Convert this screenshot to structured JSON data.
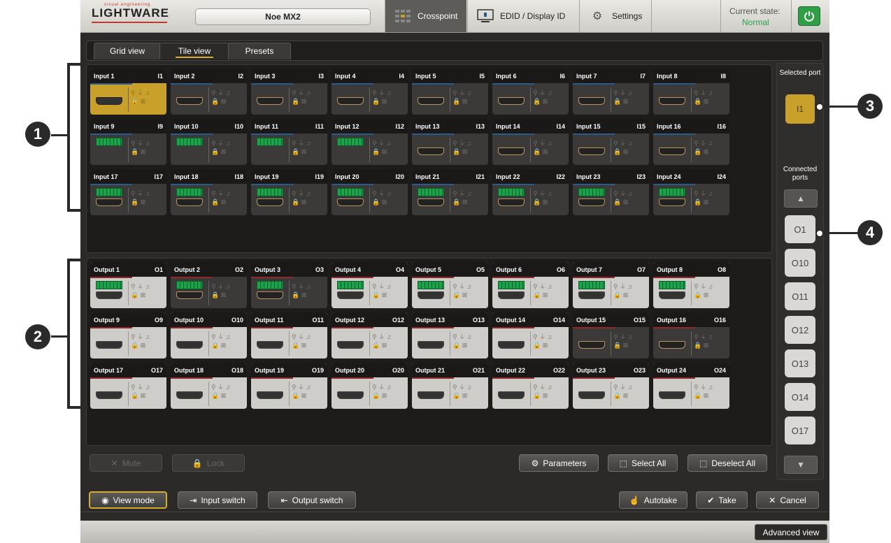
{
  "app": {
    "logo_text": "LIGHTWARE",
    "logo_tagline": "visual engineering",
    "device_name": "Noe MX2",
    "nav": {
      "crosspoint": "Crosspoint",
      "edid": "EDID / Display ID",
      "settings": "Settings"
    },
    "current_state_label": "Current state:",
    "current_state_value": "Normal"
  },
  "tabs": {
    "grid": "Grid view",
    "tile": "Tile view",
    "presets": "Presets"
  },
  "inputs": [
    {
      "label": "Input 1",
      "id": "I1",
      "kind": "hdmi",
      "selected": true
    },
    {
      "label": "Input 2",
      "id": "I2",
      "kind": "hdmi"
    },
    {
      "label": "Input 3",
      "id": "I3",
      "kind": "hdmi"
    },
    {
      "label": "Input 4",
      "id": "I4",
      "kind": "hdmi"
    },
    {
      "label": "Input 5",
      "id": "I5",
      "kind": "hdmi"
    },
    {
      "label": "Input 6",
      "id": "I6",
      "kind": "hdmi"
    },
    {
      "label": "Input 7",
      "id": "I7",
      "kind": "hdmi"
    },
    {
      "label": "Input 8",
      "id": "I8",
      "kind": "hdmi"
    },
    {
      "label": "Input 9",
      "id": "I9",
      "kind": "audio"
    },
    {
      "label": "Input 10",
      "id": "I10",
      "kind": "audio"
    },
    {
      "label": "Input 11",
      "id": "I11",
      "kind": "audio"
    },
    {
      "label": "Input 12",
      "id": "I12",
      "kind": "audio"
    },
    {
      "label": "Input 13",
      "id": "I13",
      "kind": "hdmi"
    },
    {
      "label": "Input 14",
      "id": "I14",
      "kind": "hdmi"
    },
    {
      "label": "Input 15",
      "id": "I15",
      "kind": "hdmi"
    },
    {
      "label": "Input 16",
      "id": "I16",
      "kind": "hdmi"
    },
    {
      "label": "Input 17",
      "id": "I17",
      "kind": "audio+hdmi"
    },
    {
      "label": "Input 18",
      "id": "I18",
      "kind": "audio+hdmi"
    },
    {
      "label": "Input 19",
      "id": "I19",
      "kind": "audio+hdmi"
    },
    {
      "label": "Input 20",
      "id": "I20",
      "kind": "audio+hdmi"
    },
    {
      "label": "Input 21",
      "id": "I21",
      "kind": "audio+hdmi"
    },
    {
      "label": "Input 22",
      "id": "I22",
      "kind": "audio+hdmi"
    },
    {
      "label": "Input 23",
      "id": "I23",
      "kind": "audio+hdmi"
    },
    {
      "label": "Input 24",
      "id": "I24",
      "kind": "audio+hdmi"
    }
  ],
  "outputs": [
    {
      "label": "Output 1",
      "id": "O1",
      "kind": "audio+hdmi",
      "connected": true
    },
    {
      "label": "Output 2",
      "id": "O2",
      "kind": "audio+hdmi"
    },
    {
      "label": "Output 3",
      "id": "O3",
      "kind": "audio+hdmi"
    },
    {
      "label": "Output 4",
      "id": "O4",
      "kind": "audio+hdmi",
      "connected": true
    },
    {
      "label": "Output 5",
      "id": "O5",
      "kind": "audio+hdmi",
      "connected": true
    },
    {
      "label": "Output 6",
      "id": "O6",
      "kind": "audio+hdmi",
      "connected": true
    },
    {
      "label": "Output 7",
      "id": "O7",
      "kind": "audio+hdmi",
      "connected": true
    },
    {
      "label": "Output 8",
      "id": "O8",
      "kind": "audio+hdmi",
      "connected": true
    },
    {
      "label": "Output 9",
      "id": "O9",
      "kind": "hdmi",
      "connected": true
    },
    {
      "label": "Output 10",
      "id": "O10",
      "kind": "hdmi",
      "connected": true
    },
    {
      "label": "Output 11",
      "id": "O11",
      "kind": "hdmi",
      "connected": true
    },
    {
      "label": "Output 12",
      "id": "O12",
      "kind": "hdmi",
      "connected": true
    },
    {
      "label": "Output 13",
      "id": "O13",
      "kind": "hdmi",
      "connected": true
    },
    {
      "label": "Output 14",
      "id": "O14",
      "kind": "hdmi",
      "connected": true
    },
    {
      "label": "Output 15",
      "id": "O15",
      "kind": "hdmi"
    },
    {
      "label": "Output 16",
      "id": "O16",
      "kind": "hdmi"
    },
    {
      "label": "Output 17",
      "id": "O17",
      "kind": "hdmi",
      "connected": true
    },
    {
      "label": "Output 18",
      "id": "O18",
      "kind": "hdmi",
      "connected": true
    },
    {
      "label": "Output 19",
      "id": "O19",
      "kind": "hdmi",
      "connected": true
    },
    {
      "label": "Output 20",
      "id": "O20",
      "kind": "hdmi",
      "connected": true
    },
    {
      "label": "Output 21",
      "id": "O21",
      "kind": "hdmi",
      "connected": true
    },
    {
      "label": "Output 22",
      "id": "O22",
      "kind": "hdmi",
      "connected": true
    },
    {
      "label": "Output 23",
      "id": "O23",
      "kind": "hdmi",
      "connected": true
    },
    {
      "label": "Output 24",
      "id": "O24",
      "kind": "hdmi",
      "connected": true
    }
  ],
  "right_panel": {
    "selected_port_label": "Selected port",
    "selected_port": "I1",
    "connected_ports_label": "Connected ports",
    "connected_ports": [
      "O1",
      "O10",
      "O11",
      "O12",
      "O13",
      "O14",
      "O17"
    ]
  },
  "actions": {
    "mute": "Mute",
    "lock": "Lock",
    "parameters": "Parameters",
    "select_all": "Select All",
    "deselect_all": "Deselect All"
  },
  "toolbar": {
    "view_mode": "View mode",
    "input_switch": "Input switch",
    "output_switch": "Output switch",
    "autotake": "Autotake",
    "take": "Take",
    "cancel": "Cancel"
  },
  "advanced_view": "Advanced view",
  "callouts": [
    "1",
    "2",
    "3",
    "4"
  ],
  "colors": {
    "accent": "#d5ad2b",
    "selected": "#c9a12a",
    "power": "#2f9e44",
    "normal_state": "#2ca14a"
  }
}
